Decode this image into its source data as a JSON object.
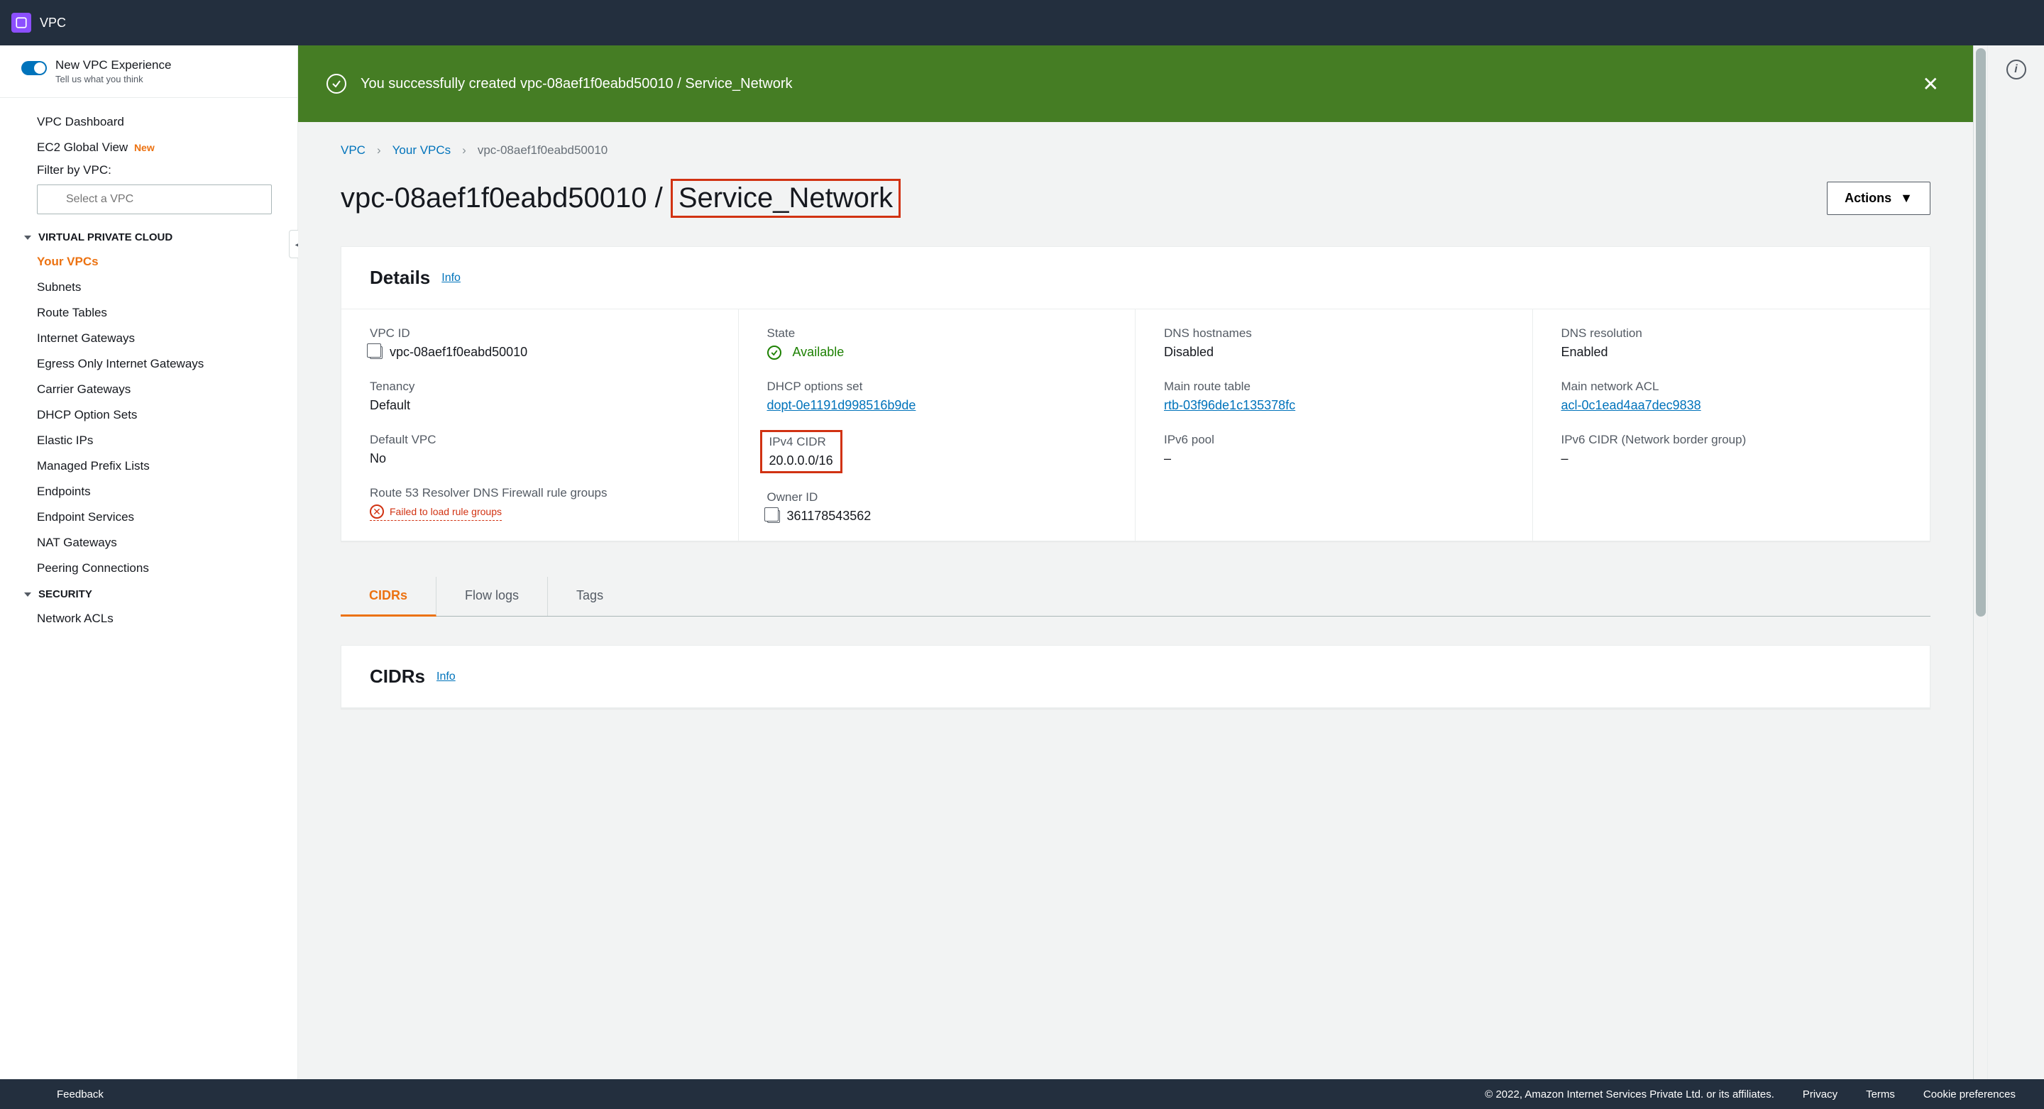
{
  "topbar": {
    "service": "VPC"
  },
  "sidebar": {
    "experience": {
      "title": "New VPC Experience",
      "subtitle": "Tell us what you think"
    },
    "dashboard": "VPC Dashboard",
    "ec2global": "EC2 Global View",
    "ec2global_badge": "New",
    "filter_label": "Filter by VPC:",
    "search_placeholder": "Select a VPC",
    "vpc_heading": "VIRTUAL PRIVATE CLOUD",
    "items": {
      "your_vpcs": "Your VPCs",
      "subnets": "Subnets",
      "route_tables": "Route Tables",
      "igw": "Internet Gateways",
      "eigw": "Egress Only Internet Gateways",
      "carrier": "Carrier Gateways",
      "dhcp": "DHCP Option Sets",
      "eip": "Elastic IPs",
      "prefix": "Managed Prefix Lists",
      "endpoints": "Endpoints",
      "endpoint_svc": "Endpoint Services",
      "nat": "NAT Gateways",
      "peering": "Peering Connections"
    },
    "security_heading": "SECURITY",
    "security": {
      "nacl": "Network ACLs"
    }
  },
  "banner": {
    "message": "You successfully created vpc-08aef1f0eabd50010 / Service_Network"
  },
  "breadcrumb": {
    "vpc": "VPC",
    "your_vpcs": "Your VPCs",
    "current": "vpc-08aef1f0eabd50010"
  },
  "page": {
    "title_prefix": "vpc-08aef1f0eabd50010 / ",
    "title_name": "Service_Network",
    "actions": "Actions"
  },
  "details": {
    "heading": "Details",
    "info": "Info",
    "vpc_id": {
      "label": "VPC ID",
      "value": "vpc-08aef1f0eabd50010"
    },
    "tenancy": {
      "label": "Tenancy",
      "value": "Default"
    },
    "default_vpc": {
      "label": "Default VPC",
      "value": "No"
    },
    "route53": {
      "label": "Route 53 Resolver DNS Firewall rule groups",
      "error": "Failed to load rule groups"
    },
    "state": {
      "label": "State",
      "value": "Available"
    },
    "dhcp": {
      "label": "DHCP options set",
      "value": "dopt-0e1191d998516b9de"
    },
    "ipv4cidr": {
      "label": "IPv4 CIDR",
      "value": "20.0.0.0/16"
    },
    "owner": {
      "label": "Owner ID",
      "value": "361178543562"
    },
    "dns_host": {
      "label": "DNS hostnames",
      "value": "Disabled"
    },
    "main_rt": {
      "label": "Main route table",
      "value": "rtb-03f96de1c135378fc"
    },
    "ipv6pool": {
      "label": "IPv6 pool",
      "value": "–"
    },
    "dns_res": {
      "label": "DNS resolution",
      "value": "Enabled"
    },
    "main_acl": {
      "label": "Main network ACL",
      "value": "acl-0c1ead4aa7dec9838"
    },
    "ipv6cidr": {
      "label": "IPv6 CIDR (Network border group)",
      "value": "–"
    }
  },
  "tabs": {
    "cidrs": "CIDRs",
    "flowlogs": "Flow logs",
    "tags": "Tags"
  },
  "cidrs_panel": {
    "heading": "CIDRs",
    "info": "Info"
  },
  "footer": {
    "feedback": "Feedback",
    "copyright": "© 2022, Amazon Internet Services Private Ltd. or its affiliates.",
    "privacy": "Privacy",
    "terms": "Terms",
    "cookie": "Cookie preferences"
  }
}
